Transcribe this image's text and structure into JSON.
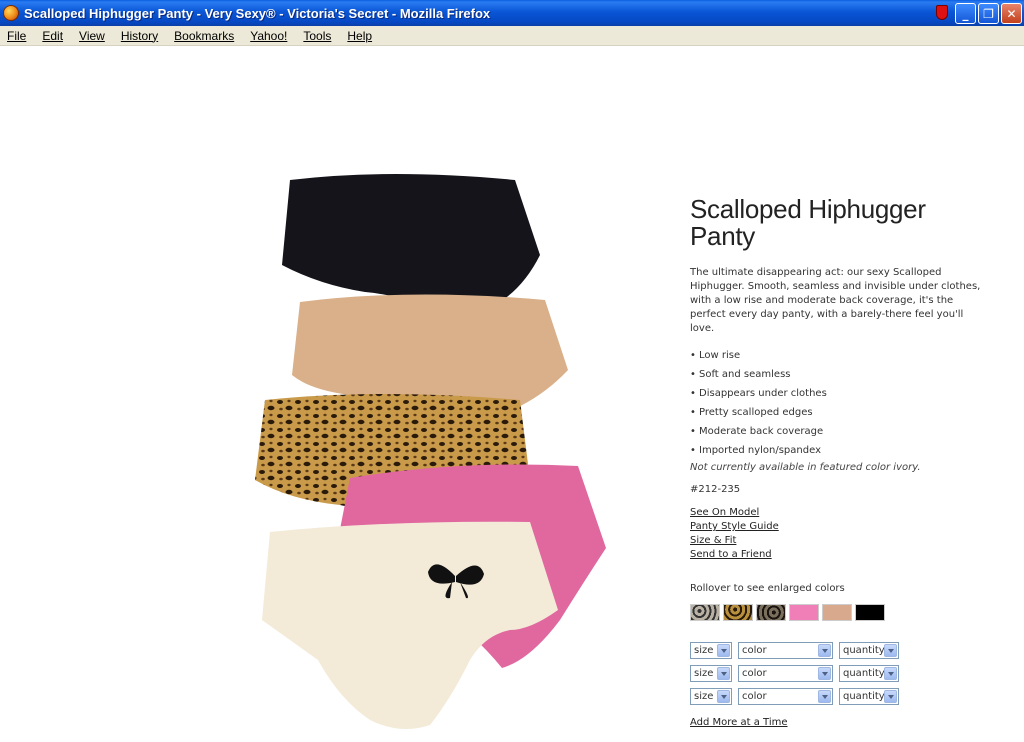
{
  "window": {
    "title": "Scalloped Hiphugger Panty - Very Sexy® - Victoria's Secret - Mozilla Firefox",
    "minimize_glyph": "_",
    "maximize_glyph": "❐",
    "close_glyph": "✕"
  },
  "menu": [
    "File",
    "Edit",
    "View",
    "History",
    "Bookmarks",
    "Yahoo!",
    "Tools",
    "Help"
  ],
  "product": {
    "name": "Scalloped Hiphugger Panty",
    "description": "The ultimate disappearing act: our sexy Scalloped Hiphugger. Smooth, seamless and invisible under clothes, with a low rise and moderate back coverage, it's the perfect every day panty, with a barely-there feel you'll love.",
    "features": [
      "Low rise",
      "Soft and seamless",
      "Disappears under clothes",
      "Pretty scalloped edges",
      "Moderate back coverage",
      "Imported nylon/spandex"
    ],
    "note": "Not currently available in featured color ivory.",
    "sku": "#212-235",
    "links": [
      "See On Model",
      "Panty Style Guide",
      "Size & Fit",
      "Send to a Friend"
    ],
    "rollover_text": "Rollover to see enlarged colors",
    "swatches": [
      {
        "name": "leopard-gray",
        "color": "#8a8479"
      },
      {
        "name": "leopard-gold",
        "color": "#9a7a3a"
      },
      {
        "name": "leopard-dark",
        "color": "#5c5448"
      },
      {
        "name": "pink",
        "color": "#f07fb8"
      },
      {
        "name": "nude",
        "color": "#d9a98d"
      },
      {
        "name": "black",
        "color": "#000000"
      }
    ],
    "order_rows": [
      {
        "size": "size",
        "color": "color",
        "quantity": "quantity"
      },
      {
        "size": "size",
        "color": "color",
        "quantity": "quantity"
      },
      {
        "size": "size",
        "color": "color",
        "quantity": "quantity"
      }
    ],
    "add_more": "Add More at a Time"
  }
}
